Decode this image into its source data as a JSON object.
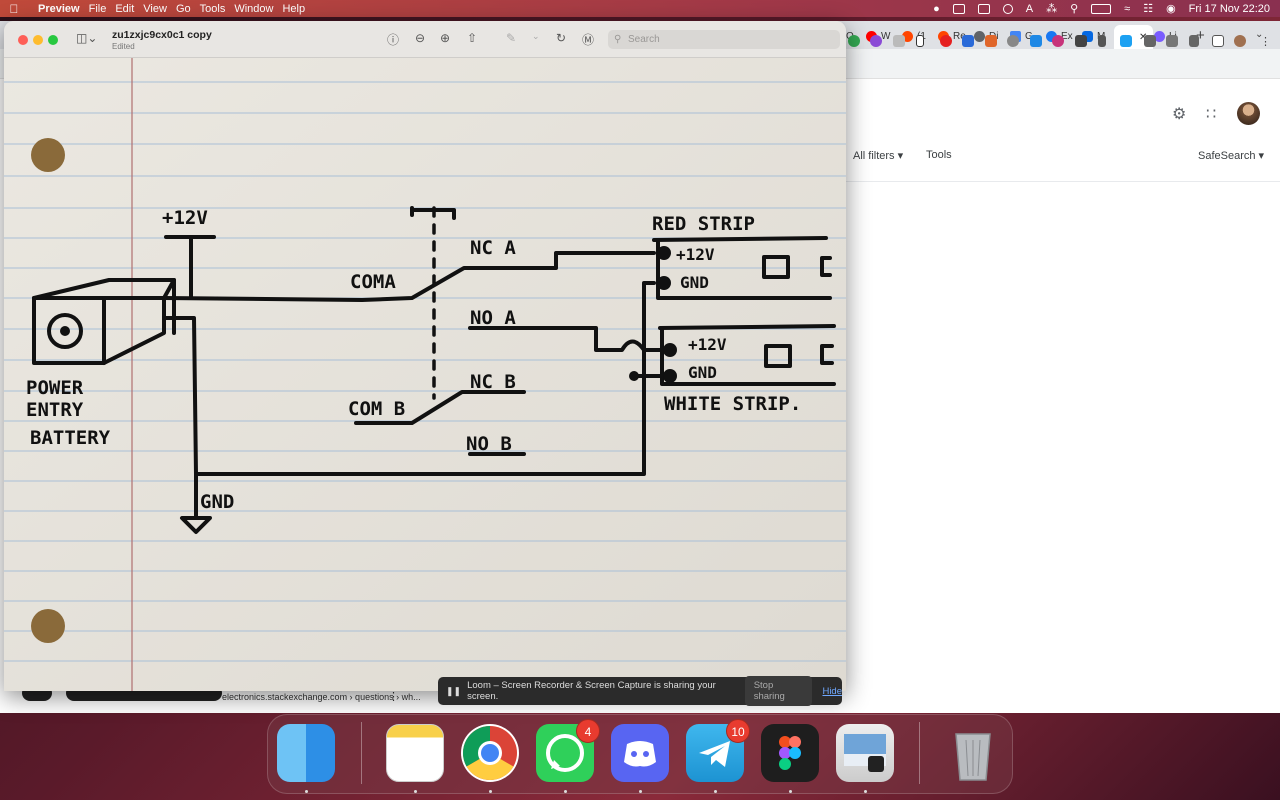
{
  "menubar": {
    "app": "Preview",
    "items": [
      "File",
      "Edit",
      "View",
      "Go",
      "Tools",
      "Window",
      "Help"
    ],
    "datetime": "Fri 17 Nov  22:20"
  },
  "browser": {
    "tabs": [
      {
        "label": "O",
        "color": "#5f6368"
      },
      {
        "label": "W",
        "color": "#ff0000"
      },
      {
        "label": "(1",
        "color": "#ff4500"
      },
      {
        "label": "Re",
        "color": "#ff4500"
      },
      {
        "label": "Di",
        "color": "#5f6368"
      },
      {
        "label": "G",
        "color": "#4285f4"
      },
      {
        "label": "Ex",
        "color": "#1877f2"
      },
      {
        "label": "M",
        "color": "#0668e1"
      },
      {
        "label": "Li",
        "color": "#7a5cff"
      }
    ],
    "new_tab": "+",
    "filters": {
      "all_filters": "All filters",
      "tools": "Tools",
      "safesearch": "SafeSearch"
    },
    "status_url": "electronics.stackexchange.com › questions › wh...",
    "status_more": "⋮"
  },
  "preview": {
    "title": "zu1zxjc9cx0c1 copy",
    "subtitle": "Edited",
    "search_placeholder": "Search"
  },
  "diagram": {
    "labels": {
      "plus12v_top": "+12V",
      "power": "POWER",
      "entry": "ENTRY",
      "battery": "BATTERY",
      "gnd_main": "GND",
      "com_a": "COMA",
      "nc_a": "NC A",
      "no_a": "NO A",
      "com_b": "COM B",
      "nc_b": "NC B",
      "no_b": "NO B",
      "red_strip": "RED STRIP",
      "red_12v": "+12V",
      "red_gnd": "GND",
      "white_12v": "+12V",
      "white_gnd": "GND",
      "white_strip": "WHITE STRIP."
    }
  },
  "loom": {
    "message": "Loom – Screen Recorder & Screen Capture is sharing your screen.",
    "stop": "Stop sharing",
    "hide": "Hide"
  },
  "dock": {
    "apps": [
      "Finder",
      "Notes",
      "Chrome",
      "WhatsApp",
      "Discord",
      "Telegram",
      "Figma",
      "Preview",
      "Trash"
    ],
    "whatsapp_badge": "4",
    "telegram_badge": "10"
  }
}
